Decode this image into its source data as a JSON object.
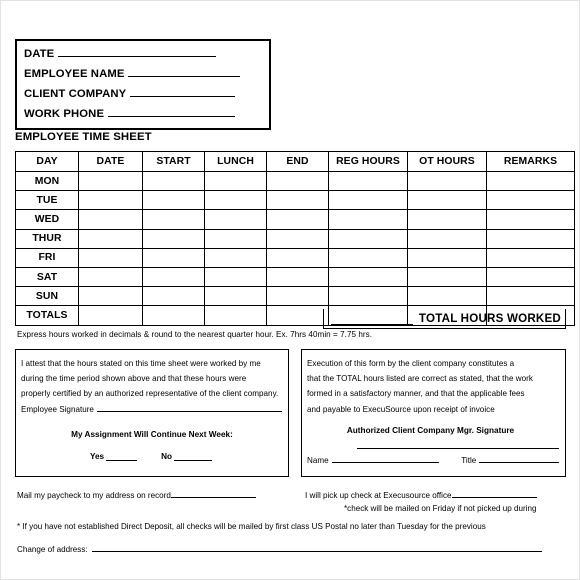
{
  "header_box": {
    "fields": [
      {
        "label": "DATE",
        "value": "",
        "rule_class": "r1"
      },
      {
        "label": "EMPLOYEE NAME",
        "value": "",
        "rule_class": "r2"
      },
      {
        "label": "CLIENT COMPANY",
        "value": "",
        "rule_class": "r3"
      },
      {
        "label": "WORK PHONE",
        "value": "",
        "rule_class": "r4"
      }
    ]
  },
  "section_title": "EMPLOYEE TIME SHEET",
  "timesheet_table": {
    "columns": [
      "DAY",
      "DATE",
      "START",
      "LUNCH",
      "END",
      "REG HOURS",
      "OT HOURS",
      "REMARKS"
    ],
    "rows": [
      {
        "day": "MON",
        "date": "",
        "start": "",
        "lunch": "",
        "end": "",
        "reg_hours": "",
        "ot_hours": "",
        "remarks": ""
      },
      {
        "day": "TUE",
        "date": "",
        "start": "",
        "lunch": "",
        "end": "",
        "reg_hours": "",
        "ot_hours": "",
        "remarks": ""
      },
      {
        "day": "WED",
        "date": "",
        "start": "",
        "lunch": "",
        "end": "",
        "reg_hours": "",
        "ot_hours": "",
        "remarks": ""
      },
      {
        "day": "THUR",
        "date": "",
        "start": "",
        "lunch": "",
        "end": "",
        "reg_hours": "",
        "ot_hours": "",
        "remarks": ""
      },
      {
        "day": "FRI",
        "date": "",
        "start": "",
        "lunch": "",
        "end": "",
        "reg_hours": "",
        "ot_hours": "",
        "remarks": ""
      },
      {
        "day": "SAT",
        "date": "",
        "start": "",
        "lunch": "",
        "end": "",
        "reg_hours": "",
        "ot_hours": "",
        "remarks": ""
      },
      {
        "day": "SUN",
        "date": "",
        "start": "",
        "lunch": "",
        "end": "",
        "reg_hours": "",
        "ot_hours": "",
        "remarks": ""
      },
      {
        "day": "TOTALS",
        "date": "",
        "start": "",
        "lunch": "",
        "end": "",
        "reg_hours": "",
        "ot_hours": "",
        "remarks": ""
      }
    ]
  },
  "total_hours": {
    "label": "TOTAL HOURS WORKED",
    "value": ""
  },
  "express_note": "Express hours worked in decimals & round to the nearest quarter hour.  Ex.  7hrs 40min = 7.75 hrs.",
  "attestation_left": {
    "lines": [
      "I attest that the hours stated on this time sheet were worked by me",
      "during the time period shown above and that these hours were",
      "properly certified by an authorized representative of the client company."
    ],
    "signature_label": "Employee Signature",
    "signature_value": "",
    "assignment_question": "My Assignment Will Continue Next Week:",
    "yes_label": "Yes",
    "yes_value": "",
    "no_label": "No",
    "no_value": ""
  },
  "attestation_right": {
    "lines": [
      "Execution of this form by the client company constitutes a",
      "that the TOTAL hours listed are correct as stated, that the work",
      "formed in a satisfactory manner, and that the applicable fees",
      "and payable to ExecuSource upon receipt of invoice"
    ],
    "auth_signature_label": "Authorized Client Company Mgr. Signature",
    "auth_signature_value": "",
    "name_label": "Name",
    "name_value": "",
    "title_label": "Title",
    "title_value": ""
  },
  "footer": {
    "mail_label": "Mail my paycheck to my address on record",
    "mail_value": "",
    "pickup_label": "I will pick up check at Execusource office",
    "pickup_value": "",
    "friday_note": "*check will be mailed on Friday if not picked up during",
    "direct_deposit_note": "* If you have not established Direct Deposit, all checks will be mailed by first class US Postal no later than Tuesday for the previous",
    "change_of_address_label": "Change of address:",
    "change_of_address_value": ""
  }
}
